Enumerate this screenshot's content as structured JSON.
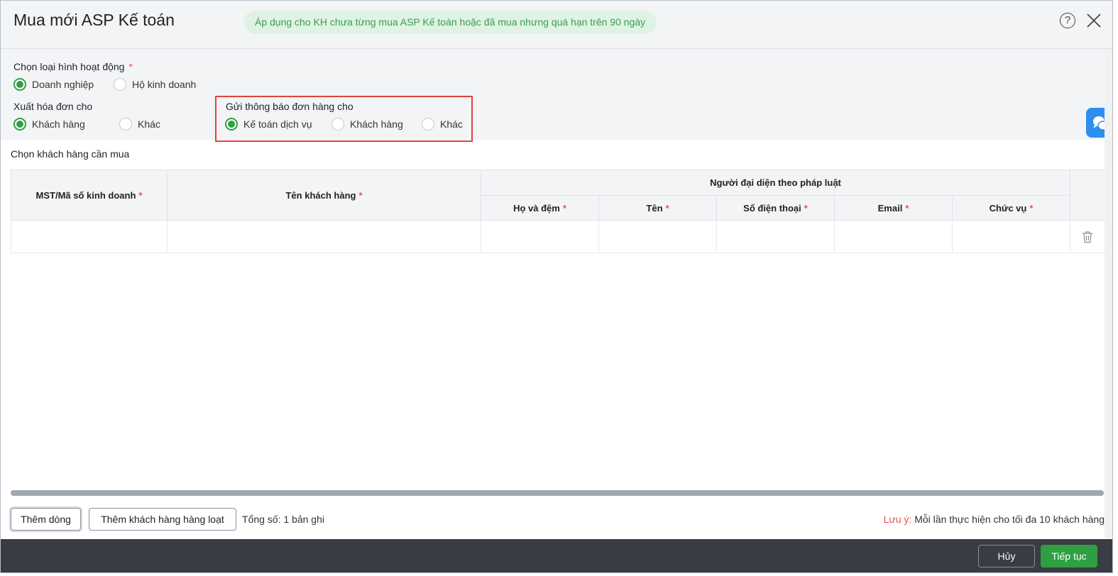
{
  "header": {
    "title": "Mua mới ASP Kế toán",
    "notice": "Áp dụng cho KH chưa từng mua ASP Kế toán hoặc đã mua nhưng quá hạn trên 90 ngày",
    "help_icon": "?"
  },
  "filters": {
    "activity_type": {
      "label": "Chọn loại hình hoạt động",
      "required_mark": "*",
      "options": [
        {
          "label": "Doanh nghiệp",
          "selected": true
        },
        {
          "label": "Hộ kinh doanh",
          "selected": false
        }
      ]
    },
    "invoice_for": {
      "label": "Xuất hóa đơn cho",
      "options": [
        {
          "label": "Khách hàng",
          "selected": true
        },
        {
          "label": "Khác",
          "selected": false
        }
      ]
    },
    "notify_to": {
      "label": "Gửi thông báo đơn hàng cho",
      "options": [
        {
          "label": "Kế toán dịch vụ",
          "selected": true
        },
        {
          "label": "Khách hàng",
          "selected": false
        },
        {
          "label": "Khác",
          "selected": false
        }
      ]
    }
  },
  "table": {
    "section_title": "Chọn khách hàng cần mua",
    "required_mark": "*",
    "columns": {
      "tax_code": "MST/Mã số kinh doanh",
      "customer_name": "Tên khách hàng",
      "legal_rep_group": "Người đại diện theo pháp luật",
      "last_middle_name": "Họ và đệm",
      "first_name": "Tên",
      "phone": "Số điện thoại",
      "email": "Email",
      "position": "Chức vụ"
    },
    "rows": [
      {
        "tax_code": "",
        "customer_name": "",
        "last_middle_name": "",
        "first_name": "",
        "phone": "",
        "email": "",
        "position": ""
      }
    ]
  },
  "actions": {
    "add_row": "Thêm dòng",
    "add_bulk": "Thêm khách hàng hàng loạt",
    "total": "Tổng số: 1 bản ghi",
    "note_label": "Lưu ý:",
    "note_text": "Mỗi lần thực hiện cho tối đa 10 khách hàng"
  },
  "footer": {
    "cancel": "Hủy",
    "next": "Tiếp tục"
  },
  "colors": {
    "accent_green": "#2ea043",
    "highlight_red": "#e0443b",
    "notice_bg": "#dff3e4",
    "chat_blue": "#2d8ef0"
  }
}
